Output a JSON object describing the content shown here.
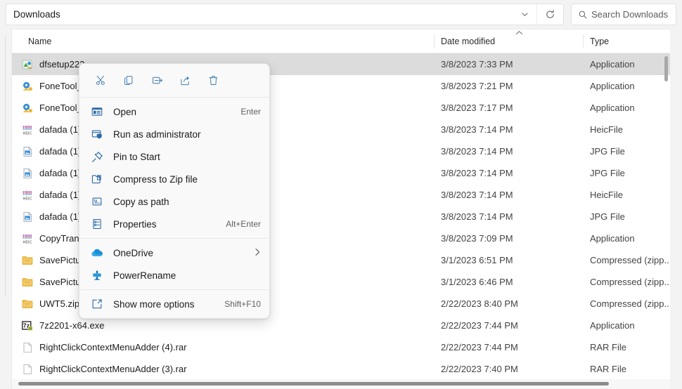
{
  "window": {
    "title": "Downloads"
  },
  "addressbar": {
    "path": "Downloads",
    "chevron_icon": "chevron-down-icon",
    "refresh_icon": "refresh-icon"
  },
  "search": {
    "placeholder": "Search Downloads",
    "icon": "search-icon"
  },
  "columns": {
    "name": "Name",
    "date_modified": "Date modified",
    "type": "Type",
    "sort_indicator": "chevron-up-icon"
  },
  "files": [
    {
      "name": "dfsetup222.",
      "date": "3/8/2023 7:33 PM",
      "type": "Application",
      "icon": "app-green-icon",
      "selected": true
    },
    {
      "name": "FoneTool_fr",
      "date": "3/8/2023 7:21 PM",
      "type": "Application",
      "icon": "app-yellow-icon",
      "selected": false
    },
    {
      "name": "FoneTool_s",
      "date": "3/8/2023 7:17 PM",
      "type": "Application",
      "icon": "app-yellow-icon",
      "selected": false
    },
    {
      "name": "dafada  (1)",
      "date": "3/8/2023 7:14 PM",
      "type": "HeicFile",
      "icon": "heic-icon",
      "selected": false
    },
    {
      "name": "dafada  (1)",
      "date": "3/8/2023 7:14 PM",
      "type": "JPG File",
      "icon": "jpg-icon",
      "selected": false
    },
    {
      "name": "dafada  (1)",
      "date": "3/8/2023 7:14 PM",
      "type": "JPG File",
      "icon": "jpg-icon",
      "selected": false
    },
    {
      "name": "dafada  (1)",
      "date": "3/8/2023 7:14 PM",
      "type": "HeicFile",
      "icon": "heic-icon",
      "selected": false
    },
    {
      "name": "dafada  (1)",
      "date": "3/8/2023 7:14 PM",
      "type": "JPG File",
      "icon": "jpg-icon",
      "selected": false
    },
    {
      "name": "CopyTransH",
      "date": "3/8/2023 7:09 PM",
      "type": "Application",
      "icon": "heic-icon",
      "selected": false
    },
    {
      "name": "SavePicture",
      "date": "3/1/2023 6:51 PM",
      "type": "Compressed (zipp...",
      "icon": "zip-folder-icon",
      "selected": false
    },
    {
      "name": "SavePicture",
      "date": "3/1/2023 6:46 PM",
      "type": "Compressed (zipp...",
      "icon": "zip-folder-icon",
      "selected": false
    },
    {
      "name": "UWT5.zip",
      "date": "2/22/2023 8:40 PM",
      "type": "Compressed (zipp...",
      "icon": "zip-folder-icon",
      "selected": false
    },
    {
      "name": "7z2201-x64.exe",
      "date": "2/22/2023 7:44 PM",
      "type": "Application",
      "icon": "sevenzip-icon",
      "selected": false
    },
    {
      "name": "RightClickContextMenuAdder (4).rar",
      "date": "2/22/2023 7:44 PM",
      "type": "RAR File",
      "icon": "blank-doc-icon",
      "selected": false
    },
    {
      "name": "RightClickContextMenuAdder (3).rar",
      "date": "2/22/2023 7:40 PM",
      "type": "RAR File",
      "icon": "blank-doc-icon",
      "selected": false
    }
  ],
  "context_menu": {
    "toolbar": [
      {
        "name": "cut",
        "icon": "scissors-icon"
      },
      {
        "name": "copy",
        "icon": "copy-icon"
      },
      {
        "name": "rename",
        "icon": "rename-icon"
      },
      {
        "name": "share",
        "icon": "share-icon"
      },
      {
        "name": "delete",
        "icon": "trash-icon"
      }
    ],
    "items": [
      {
        "label": "Open",
        "accel": "Enter",
        "icon": "open-window-icon",
        "submenu": false
      },
      {
        "label": "Run as administrator",
        "accel": "",
        "icon": "shield-admin-icon",
        "submenu": false
      },
      {
        "label": "Pin to Start",
        "accel": "",
        "icon": "pin-icon",
        "submenu": false
      },
      {
        "label": "Compress to Zip file",
        "accel": "",
        "icon": "zip-icon",
        "submenu": false
      },
      {
        "label": "Copy as path",
        "accel": "",
        "icon": "copy-path-icon",
        "submenu": false
      },
      {
        "label": "Properties",
        "accel": "Alt+Enter",
        "icon": "properties-icon",
        "submenu": false
      },
      {
        "label": "OneDrive",
        "accel": "",
        "icon": "onedrive-cloud-icon",
        "submenu": true
      },
      {
        "label": "PowerRename",
        "accel": "",
        "icon": "powerrename-icon",
        "submenu": false
      },
      {
        "label": "Show more options",
        "accel": "Shift+F10",
        "icon": "more-options-icon",
        "submenu": false
      }
    ],
    "separator_after": [
      5,
      7
    ],
    "submenu_chevron": "chevron-right-icon"
  },
  "colors": {
    "accent": "#2e6ba8",
    "selection": "#dcdcdc",
    "menu_bg": "#f9f9f9",
    "chrome_bg": "#f3f3f3"
  }
}
